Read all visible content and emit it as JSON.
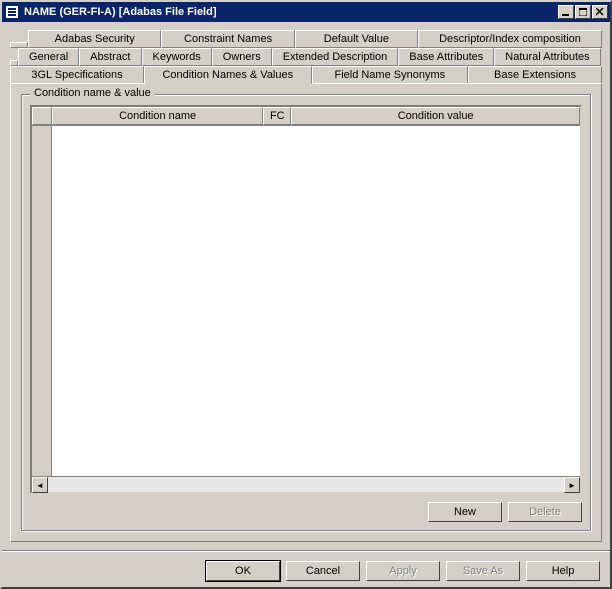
{
  "titlebar": {
    "text": "NAME (GER-FI-A) [Adabas File Field]"
  },
  "tabs": {
    "row1": [
      {
        "label": "Adabas Security"
      },
      {
        "label": "Constraint Names"
      },
      {
        "label": "Default Value"
      },
      {
        "label": "Descriptor/Index composition"
      }
    ],
    "row2": [
      {
        "label": "General"
      },
      {
        "label": "Abstract"
      },
      {
        "label": "Keywords"
      },
      {
        "label": "Owners"
      },
      {
        "label": "Extended Description"
      },
      {
        "label": "Base Attributes"
      },
      {
        "label": "Natural Attributes"
      }
    ],
    "row3": [
      {
        "label": "3GL Specifications"
      },
      {
        "label": "Condition Names & Values"
      },
      {
        "label": "Field Name Synonyms"
      },
      {
        "label": "Base Extensions"
      }
    ]
  },
  "group": {
    "title": "Condition name & value",
    "columns": {
      "rowhead": "",
      "name": "Condition name",
      "fc": "FC",
      "value": "Condition value"
    }
  },
  "panel_buttons": {
    "new": "New",
    "delete": "Delete"
  },
  "dialog_buttons": {
    "ok": "OK",
    "cancel": "Cancel",
    "apply": "Apply",
    "saveas": "Save As",
    "help": "Help"
  }
}
